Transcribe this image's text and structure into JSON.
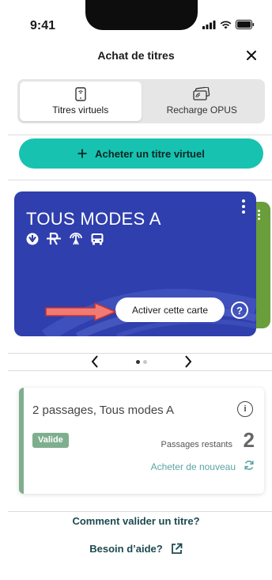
{
  "status_bar": {
    "time": "9:41"
  },
  "header": {
    "title": "Achat de titres",
    "close_icon": "close-icon"
  },
  "tabs": [
    {
      "label": "Titres virtuels",
      "icon": "phone-icon",
      "active": true
    },
    {
      "label": "Recharge OPUS",
      "icon": "card-icon",
      "active": false
    }
  ],
  "buy_button": {
    "label": "Acheter un titre virtuel",
    "icon": "plus-icon",
    "color": "#17c2b1"
  },
  "card": {
    "title": "TOUS MODES A",
    "modes": [
      "metro-icon",
      "train-icon",
      "rem-icon",
      "bus-icon"
    ],
    "activate_label": "Activer cette carte",
    "help_label": "?",
    "color": "#2f3fae",
    "next_card_color": "#6a9e3a"
  },
  "pager": {
    "current": 1,
    "total": 2
  },
  "details": {
    "title": "2 passages, Tous modes A",
    "info_label": "i",
    "status": "Valide",
    "remaining_label": "Passages restants",
    "remaining_count": "2",
    "buy_again": "Acheter de nouveau",
    "accent": "#7fae8e"
  },
  "links": {
    "validate": "Comment valider un titre?",
    "help": "Besoin d’aide?"
  }
}
